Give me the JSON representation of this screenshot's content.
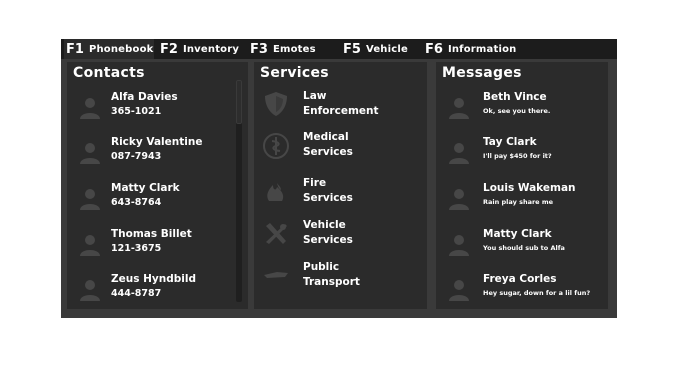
{
  "tabs": [
    {
      "key": "F1",
      "label": "Phonebook"
    },
    {
      "key": "F2",
      "label": "Inventory"
    },
    {
      "key": "F3",
      "label": "Emotes"
    },
    {
      "key": "F5",
      "label": "Vehicle"
    },
    {
      "key": "F6",
      "label": "Information"
    }
  ],
  "contacts": {
    "title": "Contacts",
    "items": [
      {
        "name": "Alfa Davies",
        "number": "365-1021"
      },
      {
        "name": "Ricky Valentine",
        "number": "087-7943"
      },
      {
        "name": "Matty Clark",
        "number": "643-8764"
      },
      {
        "name": "Thomas Billet",
        "number": "121-3675"
      },
      {
        "name": "Zeus Hyndbild",
        "number": "444-8787"
      }
    ]
  },
  "services": {
    "title": "Services",
    "items": [
      {
        "line1": "Law",
        "line2": "Enforcement",
        "icon": "shield-icon"
      },
      {
        "line1": "Medical",
        "line2": "Services",
        "icon": "medical-icon"
      },
      {
        "line1": "Fire",
        "line2": "Services",
        "icon": "fire-icon"
      },
      {
        "line1": "Vehicle",
        "line2": "Services",
        "icon": "wrench-icon"
      },
      {
        "line1": "Public",
        "line2": "Transport",
        "icon": "bus-icon"
      }
    ]
  },
  "messages": {
    "title": "Messages",
    "items": [
      {
        "name": "Beth Vince",
        "text": "Ok, see you there."
      },
      {
        "name": "Tay Clark",
        "text": "I'll pay $450 for it?"
      },
      {
        "name": "Louis Wakeman",
        "text": "Rain play share me"
      },
      {
        "name": "Matty Clark",
        "text": "You should sub to Alfa"
      },
      {
        "name": "Freya Corles",
        "text": "Hey sugar, down for a lil fun?"
      }
    ]
  },
  "colors": {
    "frame": "#3a3a3a",
    "tabbar": "#1c1c1c",
    "panel": "#2b2b2b",
    "icon": "#4a4a4a",
    "text": "#ffffff"
  }
}
